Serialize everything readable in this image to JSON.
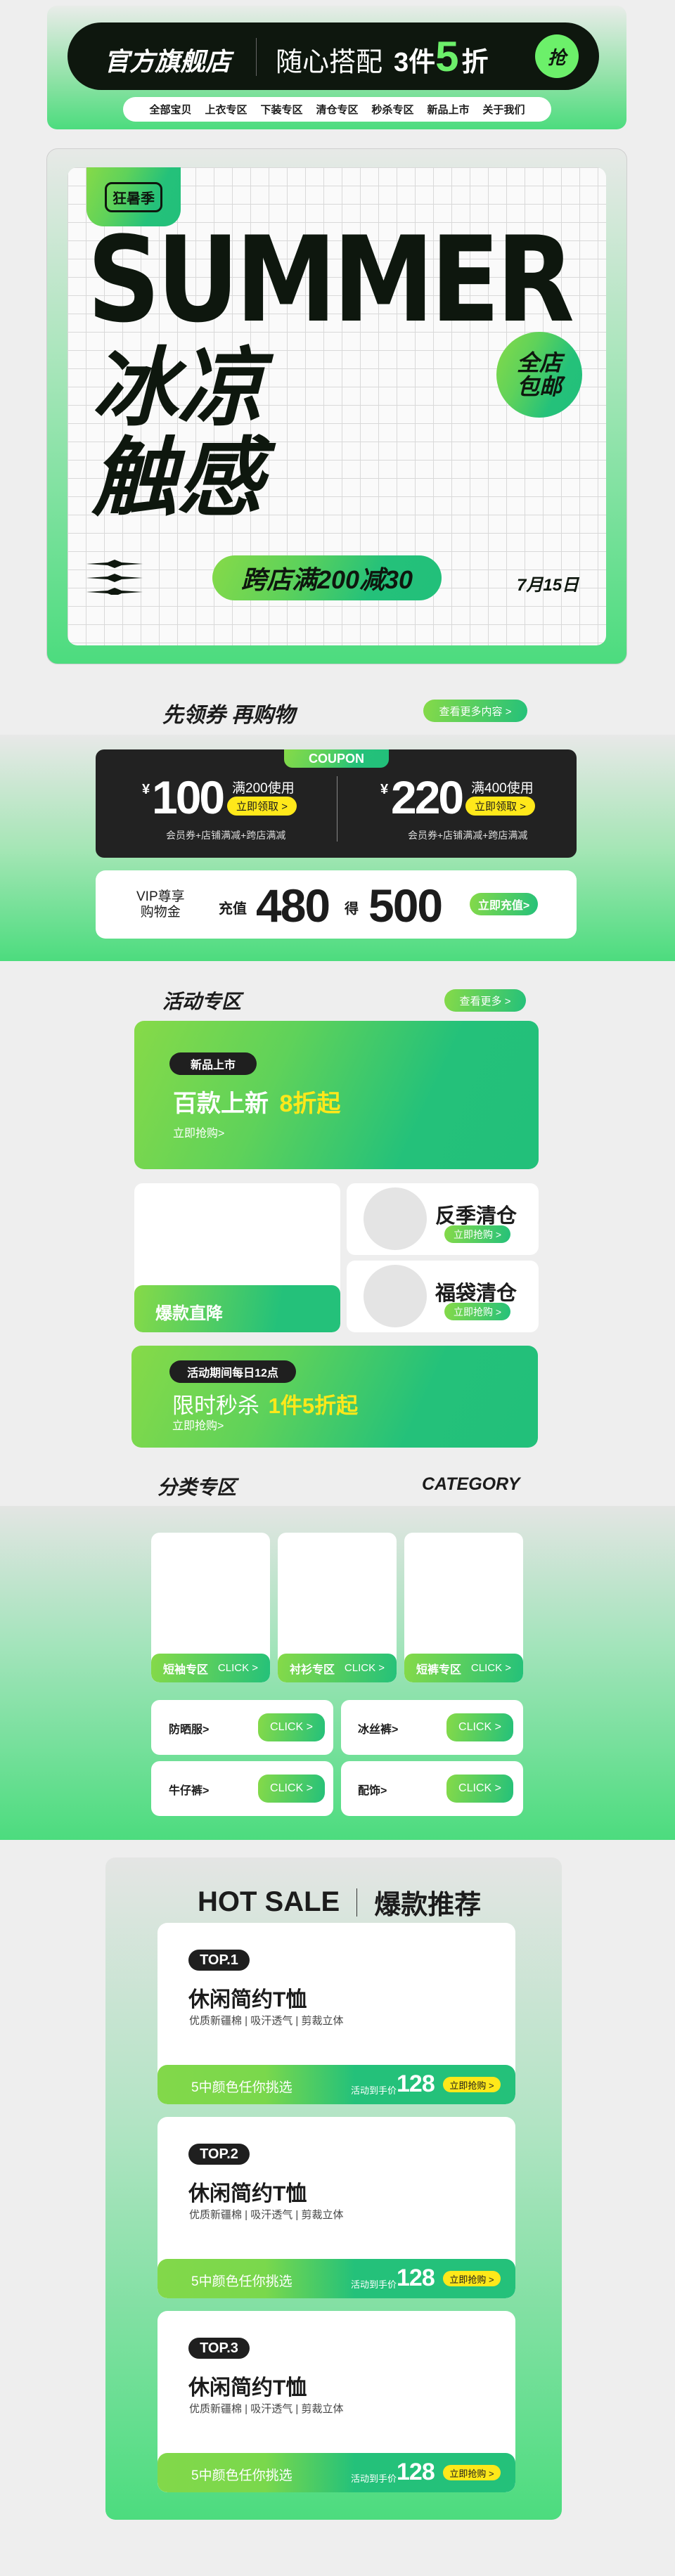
{
  "colors": {
    "brand_green": "#24c17a",
    "light_green": "#86da48",
    "bright_green": "#4fdf7f",
    "dark": "#0e170e",
    "yellow": "#ffe81a",
    "background": "#eeeeee"
  },
  "header": {
    "store_name": "官方旗舰店",
    "promo_text": "随心搭配",
    "promo_count": "3件",
    "promo_number": "5",
    "promo_unit": "折",
    "grab_button": "抢"
  },
  "nav": {
    "items": [
      "全部宝贝",
      "上衣专区",
      "下装专区",
      "清仓专区",
      "秒杀专区",
      "新品上市",
      "关于我们"
    ]
  },
  "hero": {
    "badge": "狂暑季",
    "title": "SUMMER",
    "line1": "冰凉",
    "line2": "触感",
    "free_shipping_line1": "全店",
    "free_shipping_line2": "包邮",
    "promo": "跨店满200减30",
    "date": "7月15日"
  },
  "coupons": {
    "heading": "先领券 再购物",
    "more": "查看更多内容 >",
    "tag": "COUPON",
    "items": [
      {
        "currency": "¥",
        "amount": "100",
        "condition": "满200使用",
        "button": "立即领取 >",
        "note": "会员券+店铺满减+跨店满减"
      },
      {
        "currency": "¥",
        "amount": "220",
        "condition": "满400使用",
        "button": "立即领取 >",
        "note": "会员券+店铺满减+跨店满减"
      }
    ]
  },
  "vip": {
    "label_line1": "VIP尊享",
    "label_line2": "购物金",
    "recharge": "充值",
    "amount": "480",
    "get": "得",
    "value": "500",
    "button": "立即充值>"
  },
  "activity": {
    "heading": "活动专区",
    "more": "查看更多 >",
    "new_arrival": {
      "tag": "新品上市",
      "title": "百款上新",
      "highlight": "8折起",
      "link": "立即抢购>"
    },
    "hot_drop": "爆款直降",
    "clearance": [
      {
        "title": "反季清仓",
        "button": "立即抢购 >"
      },
      {
        "title": "福袋清仓",
        "button": "立即抢购 >"
      }
    ],
    "flash": {
      "tag": "活动期间每日12点",
      "title": "限时秒杀",
      "highlight": "1件5折起",
      "link": "立即抢购>"
    }
  },
  "category": {
    "heading": "分类专区",
    "en": "CATEGORY",
    "cards": [
      {
        "label": "短袖专区",
        "click": "CLICK >"
      },
      {
        "label": "衬衫专区",
        "click": "CLICK >"
      },
      {
        "label": "短裤专区",
        "click": "CLICK >"
      }
    ],
    "small": [
      {
        "label": "防晒服>",
        "click": "CLICK >"
      },
      {
        "label": "冰丝裤>",
        "click": "CLICK >"
      },
      {
        "label": "牛仔裤>",
        "click": "CLICK >"
      },
      {
        "label": "配饰>",
        "click": "CLICK >"
      }
    ]
  },
  "hot_sale": {
    "en": "HOT SALE",
    "cn": "爆款推荐",
    "products": [
      {
        "rank": "TOP.1",
        "name": "休闲简约T恤",
        "features": "优质新疆棉 | 吸汗透气 | 剪裁立体",
        "colors": "5中颜色任你挑选",
        "price_label": "活动到手价",
        "price": "128",
        "button": "立即抢购 >"
      },
      {
        "rank": "TOP.2",
        "name": "休闲简约T恤",
        "features": "优质新疆棉 | 吸汗透气 | 剪裁立体",
        "colors": "5中颜色任你挑选",
        "price_label": "活动到手价",
        "price": "128",
        "button": "立即抢购 >"
      },
      {
        "rank": "TOP.3",
        "name": "休闲简约T恤",
        "features": "优质新疆棉 | 吸汗透气 | 剪裁立体",
        "colors": "5中颜色任你挑选",
        "price_label": "活动到手价",
        "price": "128",
        "button": "立即抢购 >"
      }
    ]
  }
}
